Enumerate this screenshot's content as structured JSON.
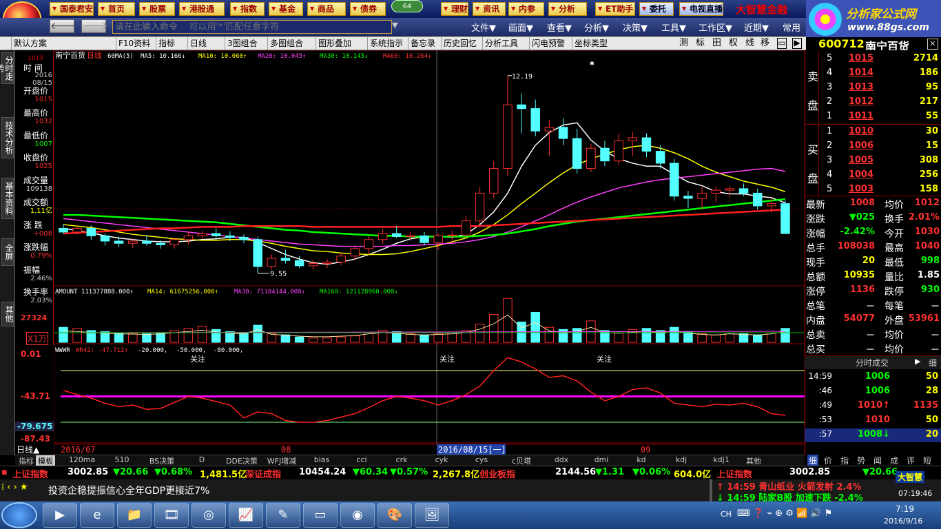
{
  "colors": {
    "up": "#ff3030",
    "down": "#54ffff",
    "white": "#ffffff",
    "yellow": "#ffff00",
    "magenta": "#ff00ff",
    "green": "#00ff00"
  },
  "top": {
    "buttons": [
      "国泰君安",
      "首页",
      "股票",
      "港股通",
      "指数",
      "基金",
      "商品",
      "债券",
      "64",
      "理财",
      "资讯",
      "内参",
      "分析",
      "ET助手",
      "委托",
      "电视直播"
    ],
    "brand": "大智慧金融",
    "site_name": "分析家公式网",
    "site_url": "www.88gs.com"
  },
  "cmd": {
    "placeholder": "请在此输入命令    可以用'*'匹配任意字符",
    "menus": [
      "文件▼",
      "画面▼",
      "查看▼",
      "分析▼",
      "决策▼",
      "工具▼",
      "工作区▼",
      "近期▼",
      "常用"
    ]
  },
  "toolbar": {
    "items": [
      "默认方案",
      "F10资料",
      "指标",
      "日线",
      "3图组合",
      "多图组合",
      "图形叠加",
      "系统指示",
      "备忘录",
      "历史回忆",
      "分析工具",
      "闪电预警",
      "坐标类型"
    ],
    "right": [
      "测",
      "标",
      "田",
      "权",
      "线",
      "移"
    ]
  },
  "stock": {
    "code": "600712",
    "name": "南宁百货"
  },
  "left_tabs": [
    "分时走势",
    "技术分析",
    "基本资料",
    "全屏",
    "其他"
  ],
  "info": {
    "labels": [
      "时 间",
      "开盘价",
      "最高价",
      "最低价",
      "收盘价",
      "成交量",
      "成交额",
      "涨 跌",
      "涨跌幅",
      "振幅",
      "换手率"
    ],
    "values": [
      "2016\n08/15",
      "1015",
      "1032",
      "1007",
      "1025",
      "109138",
      "1.11亿",
      "+008",
      "0.79%",
      "2.46%",
      "2.03%"
    ]
  },
  "main_legend": {
    "name": "南宁百货",
    "period": "日线",
    "ma_label": "60MA(5)",
    "ma5": "MA5: 10.166↓",
    "ma10": "MA10: 10.060↑",
    "ma20": "MA20: 10.045↑",
    "ma30": "MA30: 10.145↓",
    "ma60": "MA60: 10.264↓"
  },
  "price_scale": {
    "left_top": "1013",
    "high": "12.19",
    "low": "9.55"
  },
  "amount_legend": {
    "a": "AMOUNT 111377888.000↑",
    "b": "MA14: 61675256.000↑",
    "c": "MA30: 71184144.000↓",
    "d": "MA160: 121128960.000↓"
  },
  "amount_scale": {
    "top": "27324",
    "unit": "X1万"
  },
  "wr_legend": {
    "a": "WWWR",
    "b": "WR42: -47.712↑",
    "c": "-20.000,",
    "d": "-50.000,",
    "e": "-80.000,"
  },
  "wr_scale": [
    "0.01",
    "-43.71",
    "-79.675",
    "-87.43"
  ],
  "wr_labels": [
    "关注",
    "关注",
    "关注"
  ],
  "dates": {
    "a": "2016/07",
    "b": "08",
    "c": "2016/08/15[一]",
    "d": "09"
  },
  "period_label": "日线▲",
  "chart_data": {
    "type": "candlestick",
    "ohlc": [
      [
        10.15,
        10.21,
        10.08,
        10.1
      ],
      [
        10.1,
        10.18,
        10.07,
        10.15
      ],
      [
        10.15,
        10.19,
        10.0,
        10.05
      ],
      [
        10.05,
        10.08,
        9.92,
        9.98
      ],
      [
        9.98,
        10.04,
        9.9,
        9.95
      ],
      [
        9.95,
        10.02,
        9.89,
        9.98
      ],
      [
        9.98,
        10.06,
        9.92,
        9.95
      ],
      [
        9.95,
        9.99,
        9.88,
        9.93
      ],
      [
        9.93,
        10.02,
        9.88,
        10.0
      ],
      [
        10.0,
        10.1,
        9.93,
        10.05
      ],
      [
        10.05,
        10.12,
        10.01,
        10.08
      ],
      [
        10.08,
        10.15,
        10.02,
        10.05
      ],
      [
        10.05,
        10.11,
        9.98,
        10.03
      ],
      [
        10.03,
        10.07,
        9.95,
        10.0
      ],
      [
        10.0,
        10.04,
        9.55,
        9.64
      ],
      [
        9.64,
        9.8,
        9.6,
        9.75
      ],
      [
        9.75,
        9.86,
        9.68,
        9.72
      ],
      [
        9.72,
        9.78,
        9.62,
        9.65
      ],
      [
        9.65,
        9.73,
        9.6,
        9.68
      ],
      [
        9.68,
        9.74,
        9.62,
        9.7
      ],
      [
        9.7,
        9.82,
        9.66,
        9.78
      ],
      [
        9.78,
        9.92,
        9.72,
        9.88
      ],
      [
        9.88,
        10.05,
        9.8,
        10.0
      ],
      [
        10.0,
        10.14,
        9.94,
        10.08
      ],
      [
        10.08,
        10.18,
        10.02,
        10.04
      ],
      [
        10.04,
        10.1,
        9.98,
        10.05
      ],
      [
        10.05,
        10.1,
        9.92,
        9.96
      ],
      [
        9.96,
        10.08,
        9.86,
        10.05
      ],
      [
        10.05,
        10.12,
        9.97,
        10.06
      ],
      [
        10.06,
        10.32,
        10.02,
        10.25
      ],
      [
        10.25,
        10.7,
        10.2,
        10.62
      ],
      [
        10.62,
        11.05,
        10.55,
        10.95
      ],
      [
        10.95,
        12.19,
        10.85,
        11.8
      ],
      [
        11.8,
        11.95,
        11.42,
        11.75
      ],
      [
        11.75,
        11.87,
        11.38,
        11.45
      ],
      [
        11.45,
        11.6,
        11.12,
        11.5
      ],
      [
        11.5,
        11.62,
        11.26,
        11.35
      ],
      [
        11.35,
        11.48,
        10.88,
        10.95
      ],
      [
        10.95,
        11.28,
        10.9,
        11.22
      ],
      [
        11.22,
        11.32,
        10.98,
        11.05
      ],
      [
        11.05,
        11.42,
        11.0,
        11.32
      ],
      [
        11.32,
        11.44,
        11.12,
        11.36
      ],
      [
        11.36,
        11.42,
        11.1,
        11.18
      ],
      [
        11.18,
        11.26,
        10.95,
        11.02
      ],
      [
        11.02,
        11.08,
        10.52,
        10.58
      ],
      [
        10.58,
        10.65,
        10.42,
        10.55
      ],
      [
        10.55,
        10.7,
        10.4,
        10.62
      ],
      [
        10.62,
        10.7,
        10.5,
        10.66
      ],
      [
        10.66,
        10.72,
        10.56,
        10.68
      ],
      [
        10.68,
        10.75,
        10.58,
        10.62
      ],
      [
        10.62,
        10.68,
        10.4,
        10.45
      ],
      [
        10.45,
        10.55,
        10.36,
        10.48
      ],
      [
        10.48,
        10.52,
        10.2,
        10.08
      ]
    ],
    "ma_series": [
      {
        "name": "MA5",
        "color": "#ffffff",
        "values": [
          10.15,
          10.12,
          10.09,
          10.05,
          10.02,
          10.0,
          9.98,
          9.97,
          9.97,
          9.98,
          10.0,
          10.01,
          10.03,
          10.03,
          9.96,
          9.88,
          9.8,
          9.74,
          9.69,
          9.67,
          9.7,
          9.74,
          9.8,
          9.87,
          9.95,
          10.01,
          10.04,
          10.04,
          10.03,
          10.07,
          10.2,
          10.37,
          10.62,
          10.98,
          11.26,
          11.43,
          11.53,
          11.56,
          11.33,
          11.18,
          11.08,
          11.02,
          10.98,
          10.98,
          10.87,
          10.77,
          10.72,
          10.64,
          10.61,
          10.61,
          10.58,
          10.56,
          10.49
        ]
      },
      {
        "name": "MA10",
        "color": "#ffff00",
        "values": [
          10.2,
          10.18,
          10.16,
          10.13,
          10.1,
          10.07,
          10.05,
          10.03,
          10.01,
          10.0,
          9.99,
          9.99,
          10.0,
          10.0,
          9.98,
          9.95,
          9.91,
          9.88,
          9.85,
          9.84,
          9.82,
          9.81,
          9.8,
          9.8,
          9.81,
          9.84,
          9.88,
          9.92,
          9.97,
          10.02,
          10.1,
          10.2,
          10.33,
          10.48,
          10.62,
          10.76,
          10.89,
          11.0,
          11.08,
          11.14,
          11.2,
          11.24,
          11.26,
          11.22,
          11.16,
          11.08,
          10.98,
          10.9,
          10.84,
          10.78,
          10.74,
          10.7,
          10.64
        ]
      },
      {
        "name": "MA20",
        "color": "#ff40ff",
        "values": [
          10.28,
          10.26,
          10.24,
          10.22,
          10.2,
          10.18,
          10.16,
          10.14,
          10.12,
          10.1,
          10.08,
          10.06,
          10.04,
          10.02,
          10.0,
          9.98,
          9.96,
          9.94,
          9.93,
          9.92,
          9.91,
          9.91,
          9.91,
          9.91,
          9.92,
          9.92,
          9.93,
          9.94,
          9.95,
          9.97,
          10.0,
          10.04,
          10.1,
          10.17,
          10.25,
          10.33,
          10.42,
          10.5,
          10.57,
          10.63,
          10.69,
          10.73,
          10.77,
          10.8,
          10.82,
          10.84,
          10.86,
          10.88,
          10.9,
          10.92,
          10.94,
          10.95,
          10.91
        ]
      },
      {
        "name": "MA30",
        "color": "#00ff00",
        "values": [
          10.33,
          10.33,
          10.32,
          10.31,
          10.3,
          10.29,
          10.28,
          10.27,
          10.26,
          10.25,
          10.24,
          10.23,
          10.21,
          10.19,
          10.17,
          10.15,
          10.13,
          10.12,
          10.1,
          10.09,
          10.08,
          10.07,
          10.06,
          10.05,
          10.05,
          10.04,
          10.04,
          10.04,
          10.04,
          10.04,
          10.05,
          10.06,
          10.08,
          10.11,
          10.14,
          10.18,
          10.21,
          10.24,
          10.26,
          10.28,
          10.3,
          10.32,
          10.34,
          10.36,
          10.38,
          10.4,
          10.42,
          10.44,
          10.46,
          10.48,
          10.5,
          10.52,
          10.54
        ]
      },
      {
        "name": "MA60",
        "color": "#ff2020",
        "values": [
          10.08,
          10.09,
          10.1,
          10.11,
          10.12,
          10.13,
          10.14,
          10.15,
          10.15,
          10.16,
          10.17,
          10.17,
          10.17,
          10.18,
          10.18,
          10.18,
          10.18,
          10.18,
          10.17,
          10.17,
          10.17,
          10.17,
          10.17,
          10.17,
          10.17,
          10.17,
          10.17,
          10.17,
          10.18,
          10.18,
          10.18,
          10.19,
          10.2,
          10.21,
          10.22,
          10.23,
          10.24,
          10.25,
          10.26,
          10.27,
          10.28,
          10.29,
          10.3,
          10.31,
          10.32,
          10.33,
          10.34,
          10.35,
          10.36,
          10.37,
          10.38,
          10.39,
          10.4
        ]
      }
    ],
    "amount": [
      28,
      26,
      22,
      20,
      18,
      17,
      16,
      18,
      22,
      26,
      30,
      24,
      20,
      18,
      32,
      16,
      14,
      10,
      8,
      8,
      10,
      12,
      18,
      22,
      20,
      16,
      14,
      16,
      18,
      22,
      34,
      52,
      82,
      38,
      56,
      28,
      24,
      26,
      40,
      22,
      20,
      24,
      26,
      22,
      28,
      20,
      16,
      14,
      18,
      16,
      14,
      18,
      26
    ],
    "wr": [
      -43,
      -48,
      -52,
      -58,
      -62,
      -60,
      -65,
      -64,
      -57,
      -50,
      -52,
      -56,
      -60,
      -75,
      -68,
      -70,
      -78,
      -80,
      -80,
      -78,
      -74,
      -70,
      -63,
      -55,
      -50,
      -52,
      -55,
      -60,
      -55,
      -48,
      -38,
      -20,
      -5,
      -10,
      -18,
      -28,
      -26,
      -32,
      -45,
      -55,
      -50,
      -42,
      -40,
      -46,
      -58,
      -60,
      -62,
      -59,
      -60,
      -58,
      -62,
      -70,
      -72
    ],
    "ylim": [
      9.4,
      12.4
    ],
    "wr_ylim": [
      -100,
      0
    ]
  },
  "quote": {
    "sell": [
      [
        "5",
        "1015",
        "2714"
      ],
      [
        "4",
        "1014",
        "186"
      ],
      [
        "3",
        "1013",
        "95"
      ],
      [
        "2",
        "1012",
        "217"
      ],
      [
        "1",
        "1011",
        "55"
      ]
    ],
    "buy": [
      [
        "1",
        "1010",
        "30"
      ],
      [
        "2",
        "1006",
        "15"
      ],
      [
        "3",
        "1005",
        "308"
      ],
      [
        "4",
        "1004",
        "256"
      ],
      [
        "5",
        "1003",
        "158"
      ]
    ],
    "sell_label": [
      "卖",
      "盘"
    ],
    "buy_label": [
      "买",
      "盘"
    ],
    "stats": [
      [
        "最新",
        "1008",
        "均价",
        "1012"
      ],
      [
        "涨跌",
        "▼025",
        "换手",
        "2.01%"
      ],
      [
        "涨幅",
        "-2.42%",
        "今开",
        "1030"
      ],
      [
        "总手",
        "108038",
        "最高",
        "1040"
      ],
      [
        "现手",
        "20",
        "最低",
        "998"
      ],
      [
        "总额",
        "10935",
        "量比",
        "1.85"
      ],
      [
        "涨停",
        "1136",
        "跌停",
        "930"
      ],
      [
        "总笔",
        "－",
        "每笔",
        "－"
      ],
      [
        "内盘",
        "54077",
        "外盘",
        "53961"
      ],
      [
        "总卖",
        "－",
        "均价",
        "－"
      ],
      [
        "总买",
        "－",
        "均价",
        "－"
      ]
    ],
    "fs_title": "分时成交",
    "fs_btn": "细",
    "trades": [
      [
        "14:59",
        "1006",
        "50"
      ],
      [
        ":46",
        "1006",
        "28"
      ],
      [
        ":49",
        "1010↑",
        "1135"
      ],
      [
        ":53",
        "1010",
        "50"
      ],
      [
        ":57",
        "1008↓",
        "20"
      ]
    ],
    "bottom_tabs": [
      "细",
      "价",
      "指",
      "势",
      "闻",
      "成",
      "评",
      "短"
    ]
  },
  "bottom_tabs": [
    "指标",
    "模板",
    "120ma",
    "510",
    "BS决策",
    "D",
    "DDE决策",
    "WFJ增减",
    "bias",
    "cci",
    "crk",
    "cyk",
    "cys",
    "c贝塔",
    "ddx",
    "dmi",
    "kd",
    "kdj",
    "kdj1",
    "其他"
  ],
  "ticker": {
    "i1": "上证指数",
    "v1": "3002.85",
    "c1": "▼20.66",
    "p1": "▼0.68%",
    "a1": "1,481.5亿",
    "i2": "深证成指",
    "v2": "10454.24",
    "c2": "▼60.34",
    "p2": "▼0.57%",
    "a2": "2,267.8亿",
    "i3": "创业板指",
    "v3": "2144.56",
    "c3": "▼1.31",
    "p3": "▼0.06%",
    "a3": "604.0亿",
    "i4": "上证指数",
    "v4": "3002.85",
    "c4": "▼20.66"
  },
  "news": {
    "headline": "投资企稳提振信心全年GDP更接近7%",
    "n1": "14:59 青山纸业 火箭发射 2.4%",
    "n2": "14:59 陆家B股 加速下跌 -2.4%",
    "clock": "07:19:46",
    "logo": "大智慧"
  },
  "taskbar": {
    "lang": "CH",
    "time": "7:19",
    "date": "2016/9/16"
  }
}
